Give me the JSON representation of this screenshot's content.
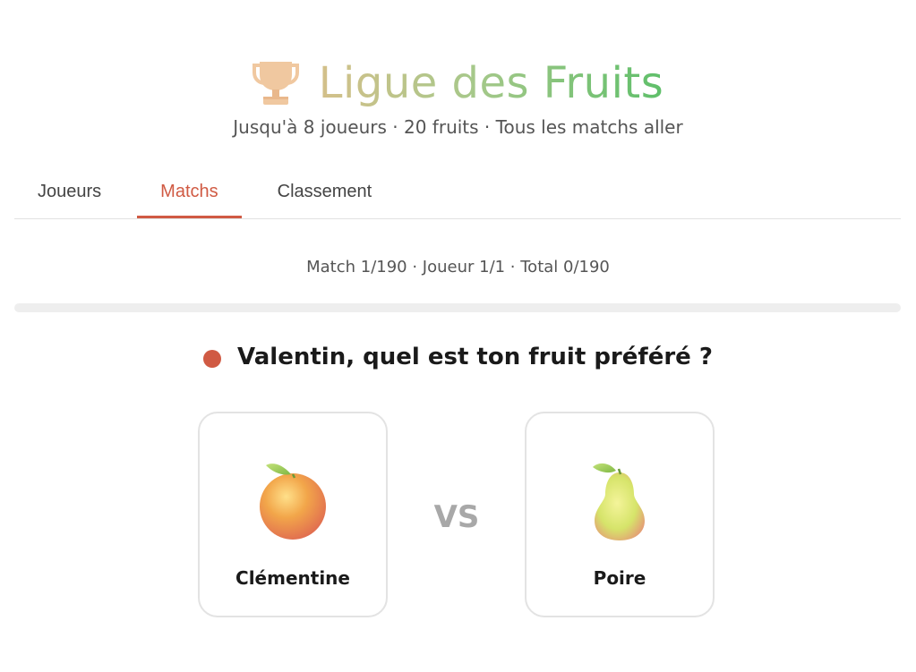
{
  "header": {
    "title": "Ligue des Fruits",
    "subtitle": "Jusqu'à 8 joueurs · 20 fruits · Tous les matchs aller",
    "icon": "trophy-icon"
  },
  "tabs": [
    {
      "label": "Joueurs",
      "active": false
    },
    {
      "label": "Matchs",
      "active": true
    },
    {
      "label": "Classement",
      "active": false
    }
  ],
  "status": {
    "text": "Match 1/190 · Joueur 1/1 · Total 0/190",
    "progress_fraction": 0
  },
  "question": {
    "text": "Valentin, quel est ton fruit préféré ?"
  },
  "match": {
    "left": {
      "name": "Clémentine",
      "icon": "clementine-icon"
    },
    "vs_label": "VS",
    "right": {
      "name": "Poire",
      "icon": "pear-icon"
    }
  },
  "colors": {
    "accent": "#d05a43",
    "title_gradient_start": "#d4c08a",
    "title_gradient_end": "#5fbf6a",
    "trophy": "#f0c8a0",
    "vs": "#a8a8a8"
  }
}
